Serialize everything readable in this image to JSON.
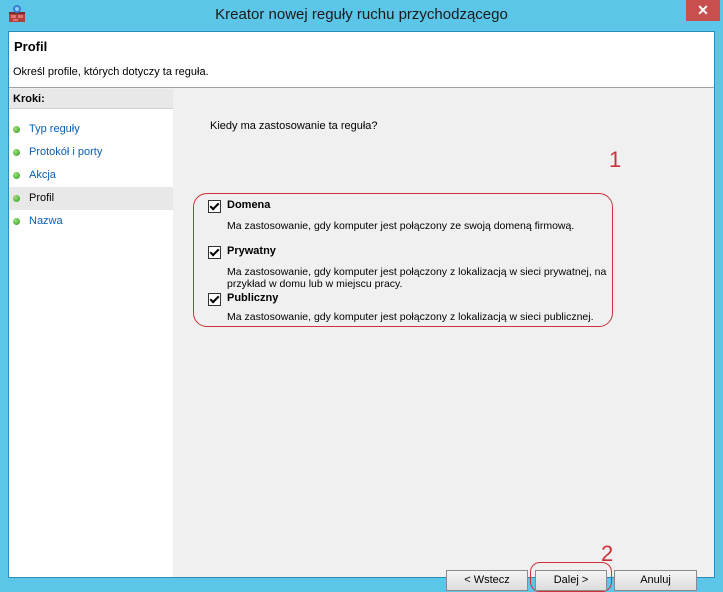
{
  "window": {
    "title": "Kreator nowej reguły ruchu przychodzącego",
    "close_label": "✕",
    "accent": "#5bc6e8"
  },
  "header": {
    "title": "Profil",
    "description": "Określ profile, których dotyczy ta reguła."
  },
  "sidebar": {
    "label": "Kroki:",
    "steps": [
      {
        "label": "Typ reguły"
      },
      {
        "label": "Protokół i porty"
      },
      {
        "label": "Akcja"
      },
      {
        "label": "Profil"
      },
      {
        "label": "Nazwa"
      }
    ],
    "active_index": 3
  },
  "main": {
    "question": "Kiedy ma zastosowanie ta reguła?",
    "options": [
      {
        "label": "Domena",
        "checked": true,
        "description": "Ma zastosowanie, gdy komputer jest połączony ze swoją domeną firmową."
      },
      {
        "label": "Prywatny",
        "checked": true,
        "description": "Ma zastosowanie, gdy komputer jest połączony z lokalizacją w sieci prywatnej, na przykład w domu lub w miejscu pracy."
      },
      {
        "label": "Publiczny",
        "checked": true,
        "description": "Ma zastosowanie, gdy komputer jest połączony z lokalizacją w sieci publicznej."
      }
    ]
  },
  "annotations": {
    "one": "1",
    "two": "2",
    "color": "#d0303a"
  },
  "buttons": {
    "back": "< Wstecz",
    "next": "Dalej >",
    "cancel": "Anuluj"
  }
}
